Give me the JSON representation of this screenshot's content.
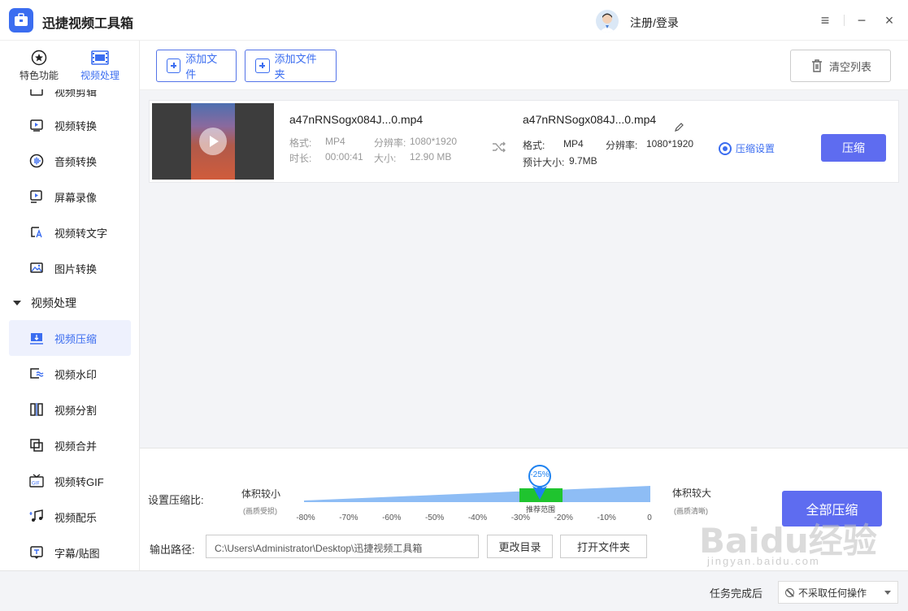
{
  "app": {
    "title": "迅捷视频工具箱",
    "login": "注册/登录"
  },
  "window": {
    "menu": "≡",
    "minimize": "−",
    "close": "×"
  },
  "topnav": [
    {
      "label": "特色功能"
    },
    {
      "label": "视频处理"
    }
  ],
  "sidebar": {
    "items": [
      {
        "label": "视频剪辑"
      },
      {
        "label": "视频转换"
      },
      {
        "label": "音频转换"
      },
      {
        "label": "屏幕录像"
      },
      {
        "label": "视频转文字"
      },
      {
        "label": "图片转换"
      }
    ],
    "group": "视频处理",
    "group_items": [
      {
        "label": "视频压缩"
      },
      {
        "label": "视频水印"
      },
      {
        "label": "视频分割"
      },
      {
        "label": "视频合并"
      },
      {
        "label": "视频转GIF"
      },
      {
        "label": "视频配乐"
      },
      {
        "label": "字幕/贴图"
      }
    ]
  },
  "toolbar": {
    "add_file": "添加文件",
    "add_folder": "添加文件夹",
    "clear": "清空列表"
  },
  "file": {
    "name": "a47nRNSogx084J...0.mp4",
    "format_label": "格式:",
    "format": "MP4",
    "res_label": "分辨率:",
    "resolution": "1080*1920",
    "duration_label": "时长:",
    "duration": "00:00:41",
    "size_label": "大小:",
    "size": "12.90 MB",
    "out_name": "a47nRNSogx084J...0.mp4",
    "out_format": "MP4",
    "out_resolution": "1080*1920",
    "est_label": "预计大小:",
    "est_size": "9.7MB",
    "settings": "压缩设置",
    "compress": "压缩"
  },
  "compression": {
    "label": "设置压缩比:",
    "smaller": "体积较小",
    "smaller_note": "(画质受损)",
    "larger": "体积较大",
    "larger_note": "(画质清晰)",
    "value": "-25%",
    "recommended": "推荐范围",
    "ticks": [
      "-80%",
      "-70%",
      "-60%",
      "-50%",
      "-40%",
      "-30%",
      "-20%",
      "-10%",
      "0"
    ]
  },
  "output": {
    "label": "输出路径:",
    "path": "C:\\Users\\Administrator\\Desktop\\迅捷视频工具箱",
    "change": "更改目录",
    "open": "打开文件夹"
  },
  "all_compress": "全部压缩",
  "status": {
    "label": "任务完成后",
    "option": "不采取任何操作"
  },
  "watermark": {
    "text": "Baidu经验",
    "sub": "jingyan.baidu.com"
  },
  "colors": {
    "accent": "#3b6df0",
    "button": "#5e6cf0",
    "recommended": "#1fc42f",
    "slider": "#8ebdf5"
  }
}
